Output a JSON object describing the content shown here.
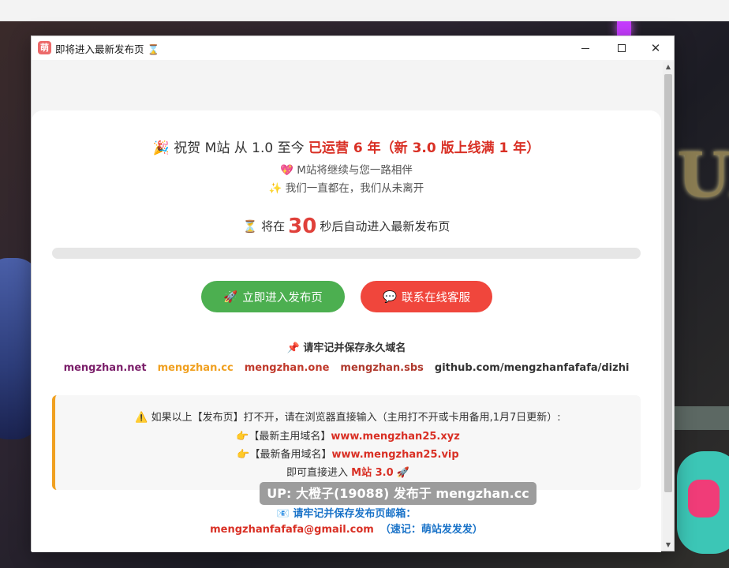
{
  "window": {
    "app_icon": "萌",
    "title": "即将进入最新发布页 ⌛"
  },
  "headline": {
    "emoji": "🎉",
    "prefix": " 祝贺 M站 从 1.0 至今 ",
    "highlight": "已运营 6 年（新 3.0 版上线满 1 年）"
  },
  "subtitles": [
    "💖 M站将继续与您一路相伴",
    "✨ 我们一直都在，我们从未离开"
  ],
  "countdown": {
    "icon": "⏳",
    "before": " 将在",
    "seconds": "30",
    "after": "秒后自动进入最新发布页",
    "progress": 0
  },
  "buttons": {
    "enter": {
      "icon": "🚀",
      "label": "立即进入发布页"
    },
    "support": {
      "icon": "💬",
      "label": "联系在线客服"
    }
  },
  "remember": "📌 请牢记并保存永久域名",
  "domains": [
    "mengzhan.net",
    "mengzhan.cc",
    "mengzhan.one",
    "mengzhan.sbs",
    "github.com/mengzhanfafafa/dizhi"
  ],
  "notice": {
    "line1": "⚠️ 如果以上【发布页】打不开，请在浏览器直接输入（主用打不开或卡用备用,1月7日更新）:",
    "primary_label": "👉【最新主用域名】",
    "primary_domain": "www.mengzhan25.xyz",
    "backup_label": "👉【最新备用域名】",
    "backup_domain": "www.mengzhan25.vip",
    "direct_before": "即可直接进入 ",
    "direct_site": "M站 3.0",
    "direct_icon": " 🚀"
  },
  "mail": {
    "label": "📧 请牢记并保存发布页邮箱：",
    "address": "mengzhanfafafa@gmail.com",
    "note": "（速记：萌站发发发）"
  },
  "watermark": "UP: 大橙子(19088) 发布于 mengzhan.cc",
  "background": {
    "sign_text": "UF"
  },
  "colors": {
    "accent_red": "#d93025",
    "button_green": "#4caf50",
    "button_red": "#f0463c",
    "notice_border": "#f0a020",
    "link_blue": "#1a73c8"
  }
}
